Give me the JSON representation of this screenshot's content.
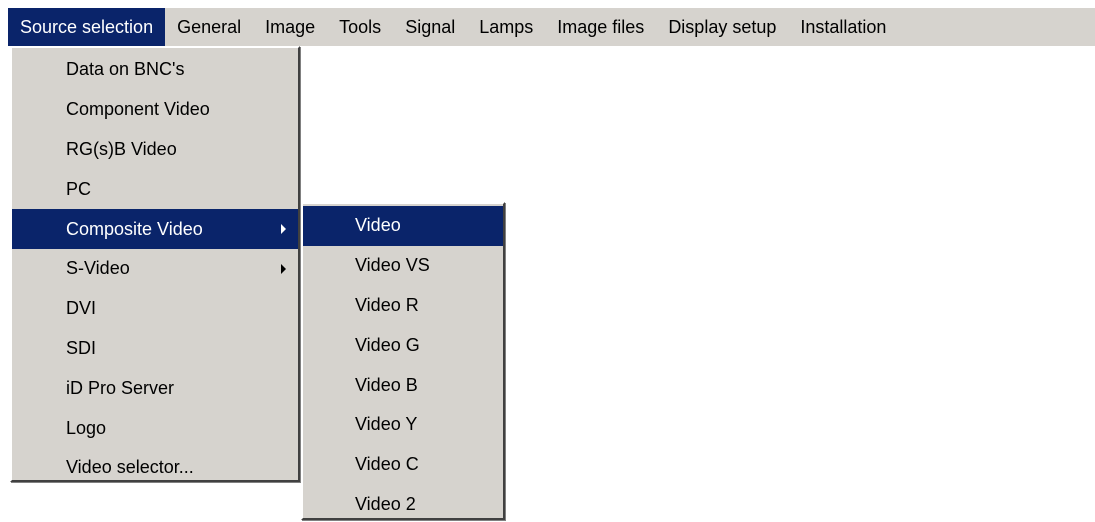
{
  "menubar": {
    "items": [
      {
        "label": "Source selection",
        "selected": true
      },
      {
        "label": "General"
      },
      {
        "label": "Image"
      },
      {
        "label": "Tools"
      },
      {
        "label": "Signal"
      },
      {
        "label": "Lamps"
      },
      {
        "label": "Image files"
      },
      {
        "label": "Display setup"
      },
      {
        "label": "Installation"
      }
    ]
  },
  "source_menu": {
    "items": [
      {
        "label": "Data on BNC's"
      },
      {
        "label": "Component Video"
      },
      {
        "label": "RG(s)B Video"
      },
      {
        "label": "PC"
      },
      {
        "label": "Composite Video",
        "has_submenu": true,
        "highlighted": true
      },
      {
        "label": "S-Video",
        "has_submenu": true
      },
      {
        "label": "DVI"
      },
      {
        "label": "SDI"
      },
      {
        "label": "iD Pro Server"
      },
      {
        "label": "Logo"
      },
      {
        "label": "Video selector..."
      }
    ]
  },
  "composite_submenu": {
    "items": [
      {
        "label": "Video",
        "highlighted": true
      },
      {
        "label": "Video VS"
      },
      {
        "label": "Video R"
      },
      {
        "label": "Video G"
      },
      {
        "label": "Video B"
      },
      {
        "label": "Video Y"
      },
      {
        "label": "Video C"
      },
      {
        "label": "Video 2"
      }
    ]
  },
  "colors": {
    "menu_background": "#d6d3ce",
    "selection_background": "#0a246a",
    "selection_text": "#ffffff"
  }
}
